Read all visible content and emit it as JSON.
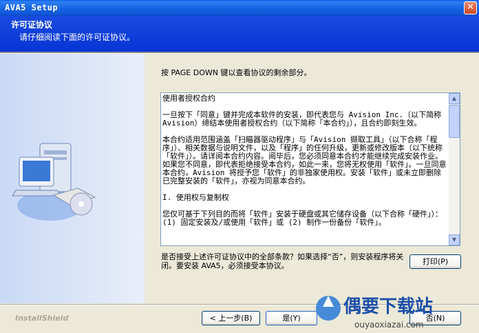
{
  "window": {
    "title": "AVA5 Setup"
  },
  "header": {
    "title": "许可证协议",
    "subtitle": "请仔细阅读下面的许可证协议。"
  },
  "instruction": "按 PAGE DOWN 键以查看协议的剩余部分。",
  "license": {
    "paragraphs": [
      "使用者授权合约",
      "一旦按下「同意」键并完成本软件的安装，即代表您与 Avision Inc.（以下简称 Avision）缔结本使用者授权合约（以下简称「本合约」），且合约即刻生效。",
      "本合约适用范围涵盖「扫瞄器驱动程序」与「Avision 撷取工具」（以下合称「程序」）、相关数据与说明文件，以及「程序」的任何升级，更新或修改版本（以下统称「软件」）。请详阅本合约内容。阅毕后，您必须同意本合约才能继续完成安装作业。如果您不同意，即代表拒绝接受本合约，如此一来，您将无权使用「软件」。一旦同意本合约，Avision 将授予您「软件」的非独家使用权。安装「软件」或未立即删除已完整安装的「软件」，亦视为同意本合约。",
      "I. 使用权与复制权",
      "您仅可基于下列目的而将「软件」安装于硬盘或其它储存设备（以下合称「硬件」）：(1) 固定安装及/或使用「软件」或 (2) 制作一份备份「软件」。"
    ]
  },
  "question": "是否接受上述许可证协议中的全部条款？如果选择“否”，则安装程序将关闭。要安装 AVA5，必须接受本协议。",
  "buttons": {
    "print": "打印(P)",
    "back": "< 上一步(B)",
    "yes": "是(Y)",
    "no": "否(N)"
  },
  "branding": {
    "installshield": "InstallShield"
  },
  "watermark": {
    "name": "偶要下载站",
    "url": "ouyaoxiazai.com"
  }
}
